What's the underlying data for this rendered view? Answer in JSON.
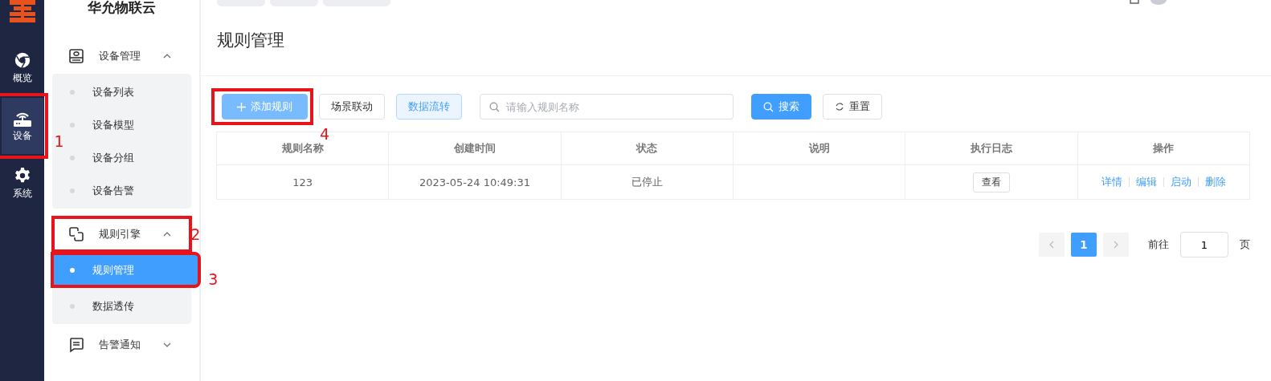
{
  "rail": {
    "items": [
      {
        "label": "概览",
        "selected": false
      },
      {
        "label": "设备",
        "selected": true,
        "annotation": "1"
      },
      {
        "label": "系统",
        "selected": false
      }
    ]
  },
  "sidebar": {
    "brand": "华允物联云",
    "groups": [
      {
        "label": "设备管理",
        "expanded": true,
        "children": [
          {
            "label": "设备列表",
            "selected": false
          },
          {
            "label": "设备模型",
            "selected": false
          },
          {
            "label": "设备分组",
            "selected": false
          },
          {
            "label": "设备告警",
            "selected": false
          }
        ]
      },
      {
        "label": "规则引擎",
        "expanded": true,
        "annotation": "2",
        "children": [
          {
            "label": "规则管理",
            "selected": true,
            "annotation": "3"
          },
          {
            "label": "数据透传",
            "selected": false
          }
        ]
      },
      {
        "label": "告警通知",
        "expanded": false
      }
    ]
  },
  "page": {
    "title": "规则管理"
  },
  "toolbar": {
    "buttons": [
      {
        "label": "添加规则",
        "kind": "primary",
        "annotation": "4"
      },
      {
        "label": "场景联动",
        "kind": "plain"
      },
      {
        "label": "数据流转",
        "kind": "light"
      }
    ],
    "search": {
      "placeholder": "请输入规则名称"
    },
    "search_button": "搜索",
    "reset_button": "重置"
  },
  "table": {
    "columns": [
      "规则名称",
      "创建时间",
      "状态",
      "说明",
      "执行日志",
      "操作"
    ],
    "rows": [
      {
        "name": "123",
        "created": "2023-05-24 10:49:31",
        "status": "已停止",
        "log_button": "查看",
        "actions": [
          "详情",
          "编辑",
          "启动",
          "删除"
        ]
      }
    ]
  },
  "pagination": {
    "pages": [
      {
        "label": "1",
        "selected": true
      }
    ],
    "goto_label": "前往",
    "goto_value": "1",
    "page_unit": "页"
  }
}
